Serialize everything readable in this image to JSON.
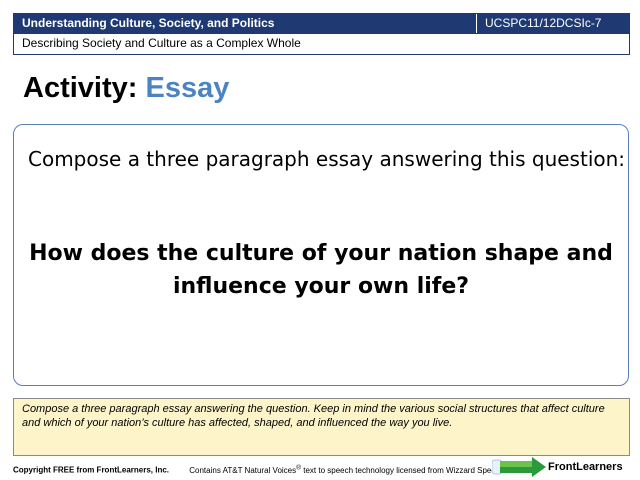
{
  "header": {
    "course": "Understanding Culture, Society, and Politics",
    "code": "UCSPC11/12DCSIc-7",
    "subtitle": "Describing Society and Culture as a Complex Whole"
  },
  "title": {
    "prefix": "Activity:",
    "highlight": "Essay"
  },
  "main": {
    "prompt": "Compose a three paragraph essay answering this question:",
    "question_line1": "How does the culture of your nation shape and",
    "question_line2": "influence your own life?"
  },
  "notes": {
    "text": "Compose a three paragraph essay answering the question. Keep in mind the various social structures that affect culture and which of your nation’s culture has affected, shaped, and influenced the way you live."
  },
  "footer": {
    "copyright": "Copyright FREE from FrontLearners, Inc.",
    "voices_pre": "Contains AT&T Natural Voices",
    "voices_reg": "®",
    "voices_post": " text to speech technology licensed from Wizzard Speech LLC",
    "logo_text": "FrontLearners"
  },
  "colors": {
    "header_bg": "#1f3a72",
    "accent": "#4a84c4",
    "notes_bg": "#fdf5c9"
  }
}
